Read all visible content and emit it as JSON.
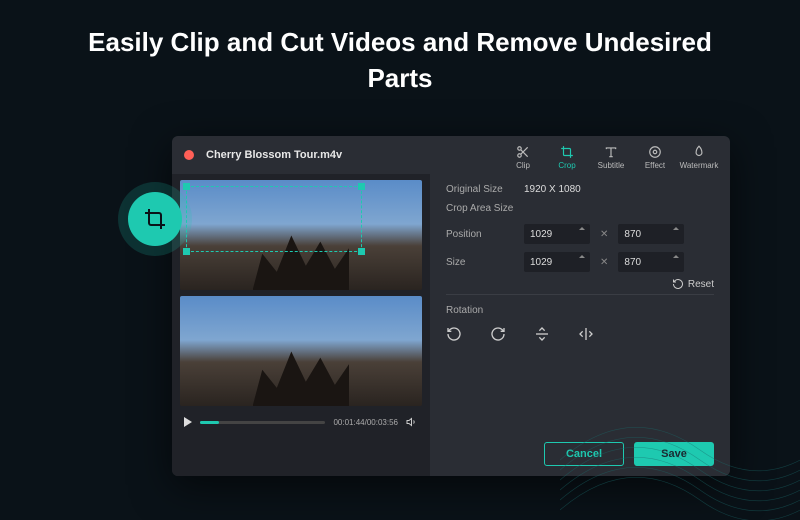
{
  "headline": "Easily Clip and Cut Videos and Remove Undesired Parts",
  "filename": "Cherry Blossom Tour.m4v",
  "tools": [
    {
      "label": "Clip",
      "name": "clip"
    },
    {
      "label": "Crop",
      "name": "crop"
    },
    {
      "label": "Subtitle",
      "name": "subtitle"
    },
    {
      "label": "Effect",
      "name": "effect"
    },
    {
      "label": "Watermark",
      "name": "watermark"
    }
  ],
  "active_tool": "crop",
  "player": {
    "time": "00:01:44/00:03:56"
  },
  "settings": {
    "original_label": "Original Size",
    "original_value": "1920 X 1080",
    "crop_area_label": "Crop Area Size",
    "position_label": "Position",
    "position_x": "1029",
    "position_y": "870",
    "size_label": "Size",
    "size_w": "1029",
    "size_h": "870",
    "reset_label": "Reset",
    "rotation_label": "Rotation"
  },
  "buttons": {
    "cancel": "Cancel",
    "save": "Save"
  }
}
